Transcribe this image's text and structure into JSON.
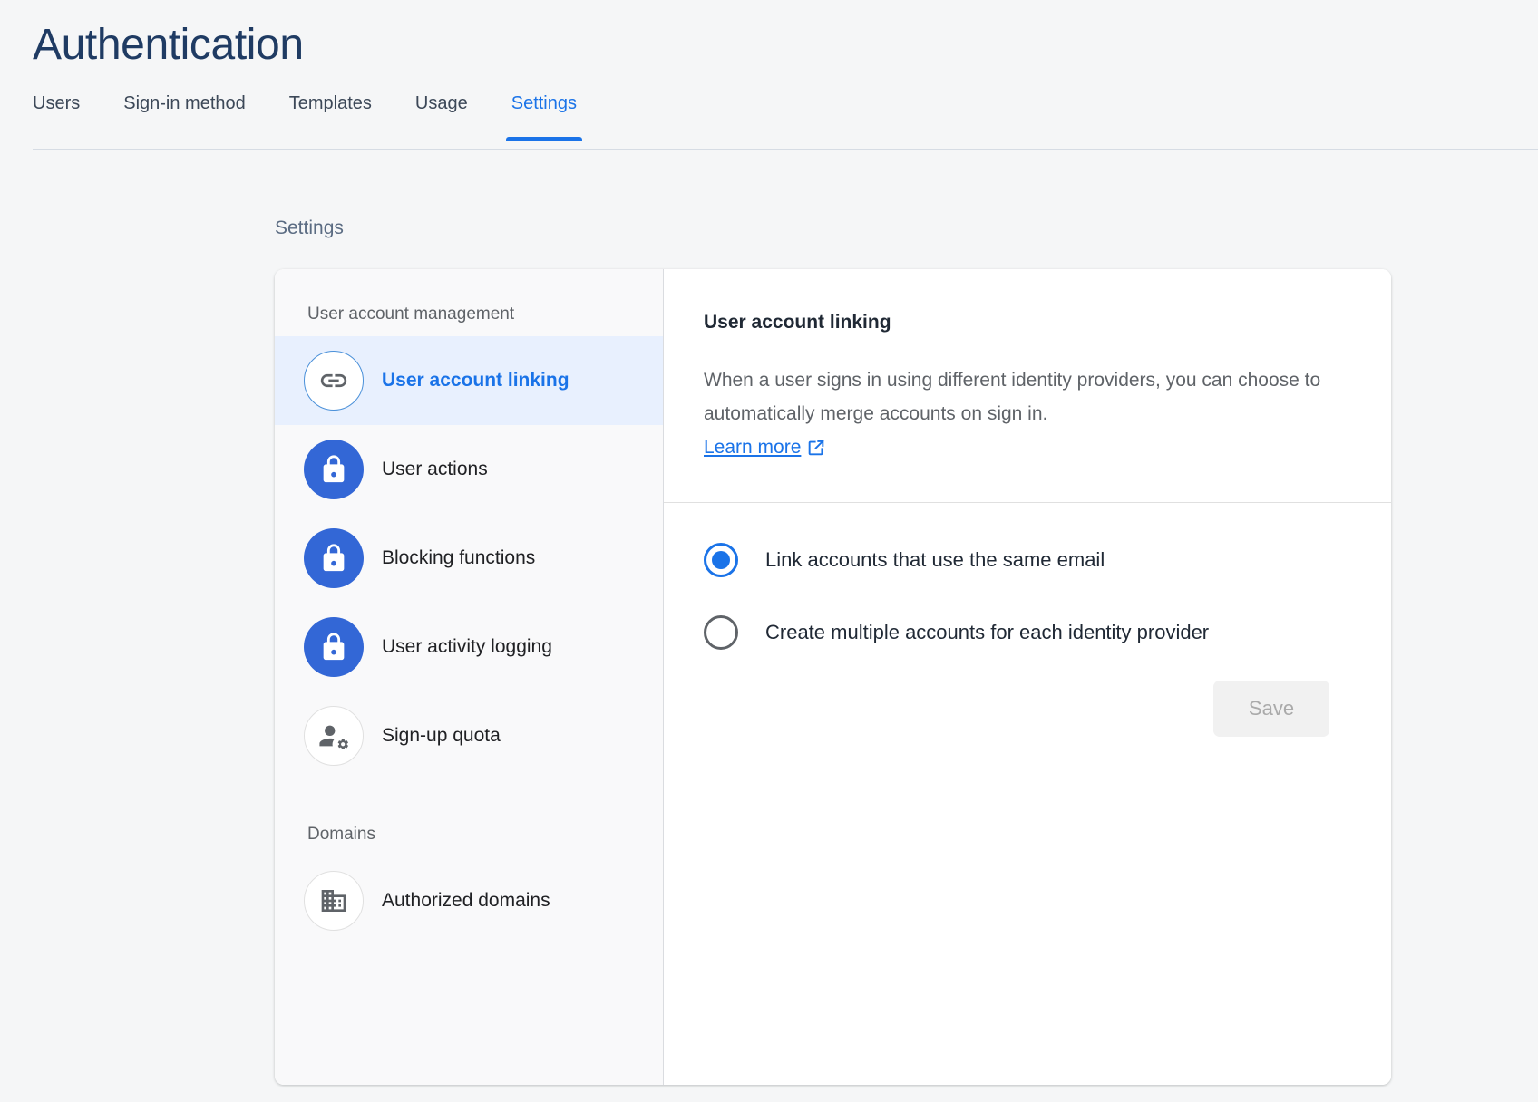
{
  "header": {
    "title": "Authentication"
  },
  "tabs": [
    {
      "label": "Users",
      "active": false
    },
    {
      "label": "Sign-in method",
      "active": false
    },
    {
      "label": "Templates",
      "active": false
    },
    {
      "label": "Usage",
      "active": false
    },
    {
      "label": "Settings",
      "active": true
    }
  ],
  "section": {
    "heading": "Settings"
  },
  "sidebar": {
    "groups": [
      {
        "label": "User account management",
        "items": [
          {
            "label": "User account linking",
            "icon": "link-icon",
            "icon_style": "outline-blue",
            "selected": true
          },
          {
            "label": "User actions",
            "icon": "lock-icon",
            "icon_style": "filled-blue",
            "selected": false
          },
          {
            "label": "Blocking functions",
            "icon": "lock-icon",
            "icon_style": "filled-blue",
            "selected": false
          },
          {
            "label": "User activity logging",
            "icon": "lock-icon",
            "icon_style": "filled-blue",
            "selected": false
          },
          {
            "label": "Sign-up quota",
            "icon": "person-settings-icon",
            "icon_style": "outline-grey",
            "selected": false
          }
        ]
      },
      {
        "label": "Domains",
        "items": [
          {
            "label": "Authorized domains",
            "icon": "building-icon",
            "icon_style": "outline-grey",
            "selected": false
          }
        ]
      }
    ]
  },
  "panel": {
    "title": "User account linking",
    "description": "When a user signs in using different identity providers, you can choose to automatically merge accounts on sign in.",
    "learn_more_label": "Learn more",
    "learn_more_icon": "external-link-icon",
    "options": [
      {
        "label": "Link accounts that use the same email",
        "checked": true
      },
      {
        "label": "Create multiple accounts for each identity provider",
        "checked": false
      }
    ],
    "save_label": "Save",
    "save_disabled": true
  },
  "colors": {
    "accent": "#1a73e8",
    "icon_blue": "#3367d6",
    "selected_row_bg": "#e8f0fe",
    "page_bg": "#f5f6f7",
    "title_color": "#1f3b63"
  }
}
